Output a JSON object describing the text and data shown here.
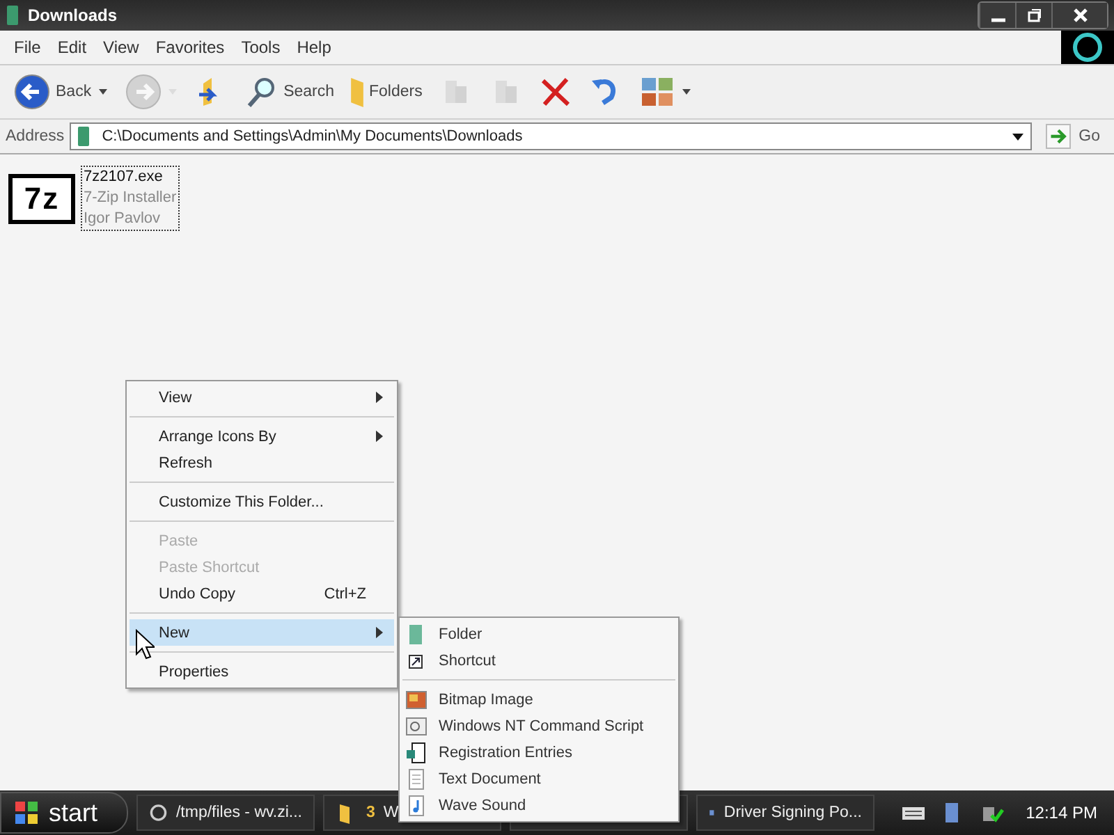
{
  "window": {
    "title": "Downloads"
  },
  "menu_bar": [
    "File",
    "Edit",
    "View",
    "Favorites",
    "Tools",
    "Help"
  ],
  "toolbar": [
    {
      "kind": "back",
      "label": "Back",
      "disabled": false
    },
    {
      "kind": "forward",
      "disabled": true
    },
    {
      "kind": "up",
      "disabled": false
    },
    {
      "kind": "search",
      "label": "Search",
      "disabled": false
    },
    {
      "kind": "folders",
      "label": "Folders",
      "disabled": false
    },
    {
      "kind": "move",
      "disabled": true
    },
    {
      "kind": "copy",
      "disabled": true
    },
    {
      "kind": "delete",
      "disabled": false
    },
    {
      "kind": "undo",
      "disabled": false
    },
    {
      "kind": "views",
      "disabled": false
    }
  ],
  "address": {
    "label": "Address",
    "value": "C:\\Documents and Settings\\Admin\\My Documents\\Downloads",
    "go": "Go"
  },
  "file": {
    "icon_text": "7z",
    "name": "7z2107.exe",
    "type": "7-Zip Installer",
    "company": "Igor Pavlov",
    "selected": true
  },
  "context_menu": [
    {
      "kind": "item",
      "label": "View",
      "disabled": false,
      "submenu": true,
      "selected": false
    },
    {
      "kind": "separator"
    },
    {
      "kind": "item",
      "label": "Arrange Icons By",
      "disabled": false,
      "submenu": true,
      "selected": false
    },
    {
      "kind": "item",
      "label": "Refresh",
      "disabled": false,
      "submenu": false,
      "selected": false
    },
    {
      "kind": "separator"
    },
    {
      "kind": "item",
      "label": "Customize This Folder...",
      "disabled": false,
      "submenu": false,
      "selected": false
    },
    {
      "kind": "separator"
    },
    {
      "kind": "item",
      "label": "Paste",
      "disabled": true,
      "submenu": false,
      "selected": false
    },
    {
      "kind": "item",
      "label": "Paste Shortcut",
      "disabled": true,
      "submenu": false,
      "selected": false
    },
    {
      "kind": "item",
      "label": "Undo Copy",
      "shortcut": "Ctrl+Z",
      "disabled": false,
      "submenu": false,
      "selected": false
    },
    {
      "kind": "separator"
    },
    {
      "kind": "item",
      "label": "New",
      "disabled": false,
      "submenu": true,
      "selected": true
    },
    {
      "kind": "separator"
    },
    {
      "kind": "item",
      "label": "Properties",
      "disabled": false,
      "submenu": false,
      "selected": false
    }
  ],
  "new_submenu": [
    {
      "kind": "folder",
      "label": "Folder"
    },
    {
      "kind": "shortcut",
      "label": "Shortcut"
    },
    {
      "kind": "separator"
    },
    {
      "kind": "bitmap",
      "label": "Bitmap Image"
    },
    {
      "kind": "script",
      "label": "Windows NT Command Script"
    },
    {
      "kind": "registry",
      "label": "Registration Entries"
    },
    {
      "kind": "text",
      "label": "Text Document"
    },
    {
      "kind": "wave",
      "label": "Wave Sound"
    }
  ],
  "taskbar": {
    "start": "start",
    "buttons": [
      {
        "kind": "globe",
        "label": "/tmp/files - wv.zi..."
      },
      {
        "kind": "folder",
        "count": "3",
        "label": "W"
      },
      {
        "kind": "hidden"
      },
      {
        "kind": "driver",
        "label": "Driver Signing Po..."
      }
    ],
    "clock": "12:14 PM"
  }
}
